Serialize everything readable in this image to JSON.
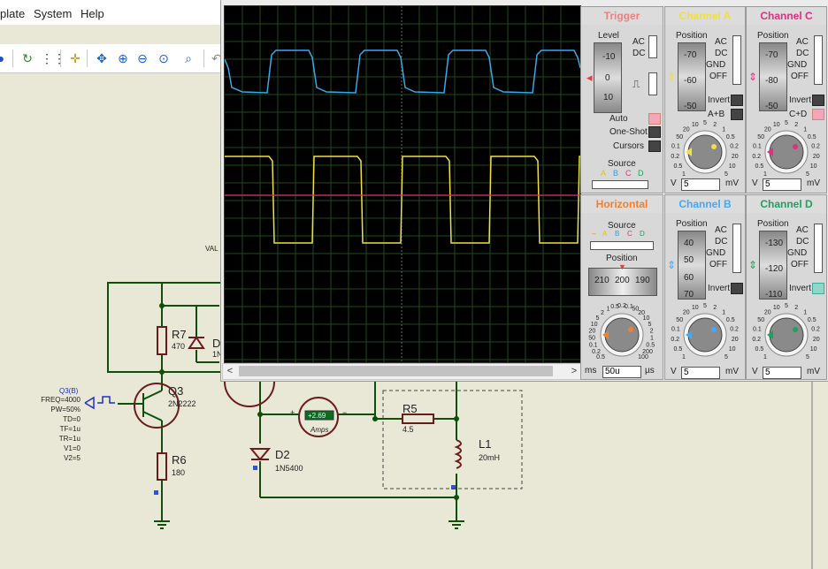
{
  "menu": {
    "items": [
      "plate",
      "System",
      "Help"
    ]
  },
  "schematic": {
    "stim": {
      "name": "Q3(B)",
      "params": [
        "FREQ=4000",
        "PW=50%",
        "TD=0",
        "TF=1u",
        "TR=1u",
        "V1=0",
        "V2=5"
      ]
    },
    "val_label": "VAL",
    "components": {
      "r7": {
        "ref": "R7",
        "value": "470"
      },
      "d_top": {
        "ref": "D",
        "value": "1N"
      },
      "q3": {
        "ref": "Q3",
        "value": "2N2222"
      },
      "r6": {
        "ref": "R6",
        "value": "180"
      },
      "d2": {
        "ref": "D2",
        "value": "1N5400"
      },
      "r5": {
        "ref": "R5",
        "value": "4.5"
      },
      "l1": {
        "ref": "L1",
        "value": "20mH"
      },
      "ammeter": {
        "reading": "+2.69",
        "unit": "Amps",
        "plus": "+",
        "minus": "−"
      }
    }
  },
  "oscilloscope": {
    "trigger": {
      "title": "Trigger",
      "level_label": "Level",
      "level_ticks": [
        "-10",
        "0",
        "10"
      ],
      "coupling": [
        "AC",
        "DC"
      ],
      "modes": [
        "Auto",
        "One-Shot",
        "Cursors"
      ],
      "source_label": "Source",
      "sources": [
        "A",
        "B",
        "C",
        "D"
      ]
    },
    "horizontal": {
      "title": "Horizontal",
      "source_label": "Source",
      "sources": [
        "A",
        "B",
        "C",
        "D"
      ],
      "position_label": "Position",
      "position_ticks": [
        "210",
        "200",
        "190"
      ],
      "timebase_value": "50u",
      "unit_left": "ms",
      "unit_right": "µs",
      "dial_labels": [
        "0.5",
        "0.2",
        "0.1",
        "50",
        "20",
        "10",
        "5",
        "2",
        "1",
        "0.5",
        "0.2",
        "0.1",
        "50",
        "20",
        "10",
        "5",
        "2",
        "1",
        "0.5",
        "200",
        "100"
      ]
    },
    "channels": [
      {
        "id": "a",
        "title": "Channel A",
        "color": "#f0e040",
        "pos_ticks": [
          "-70",
          "-60",
          "-50"
        ],
        "options": [
          "AC",
          "DC",
          "GND",
          "OFF"
        ],
        "extra": [
          "Invert",
          "A+B"
        ],
        "value": "5",
        "unit_left": "V",
        "unit_right": "mV",
        "dial_labels": [
          "1",
          "0.5",
          "0.2",
          "0.1",
          "50",
          "20",
          "10",
          "5",
          "2",
          "1",
          "0.5",
          "0.2",
          "20",
          "10",
          "5"
        ]
      },
      {
        "id": "b",
        "title": "Channel B",
        "color": "#40a8ff",
        "pos_ticks": [
          "40",
          "50",
          "60",
          "70"
        ],
        "options": [
          "AC",
          "DC",
          "GND",
          "OFF"
        ],
        "extra": [
          "Invert"
        ],
        "value": "5",
        "unit_left": "V",
        "unit_right": "mV",
        "dial_labels": [
          "1",
          "0.5",
          "0.2",
          "0.1",
          "50",
          "20",
          "10",
          "5",
          "2",
          "1",
          "0.5",
          "0.2",
          "20",
          "10",
          "5"
        ]
      },
      {
        "id": "c",
        "title": "Channel C",
        "color": "#e03080",
        "pos_ticks": [
          "-70",
          "-80",
          "-50"
        ],
        "options": [
          "AC",
          "DC",
          "GND",
          "OFF"
        ],
        "extra": [
          "Invert",
          "C+D"
        ],
        "value": "5",
        "unit_left": "V",
        "unit_right": "mV",
        "dial_labels": [
          "1",
          "0.5",
          "0.2",
          "0.1",
          "50",
          "20",
          "10",
          "5",
          "2",
          "1",
          "0.5",
          "0.2",
          "20",
          "10",
          "5"
        ]
      },
      {
        "id": "d",
        "title": "Channel D",
        "color": "#20a060",
        "pos_ticks": [
          "-130",
          "-120",
          "-110"
        ],
        "options": [
          "AC",
          "DC",
          "GND",
          "OFF"
        ],
        "extra": [
          "Invert"
        ],
        "value": "5",
        "unit_left": "V",
        "unit_right": "mV",
        "dial_labels": [
          "1",
          "0.5",
          "0.2",
          "0.1",
          "50",
          "20",
          "10",
          "5",
          "2",
          "1",
          "0.5",
          "0.2",
          "20",
          "10",
          "5"
        ]
      }
    ],
    "colors": {
      "trigger_title": "#f08080",
      "horizontal_title": "#f08030"
    }
  }
}
